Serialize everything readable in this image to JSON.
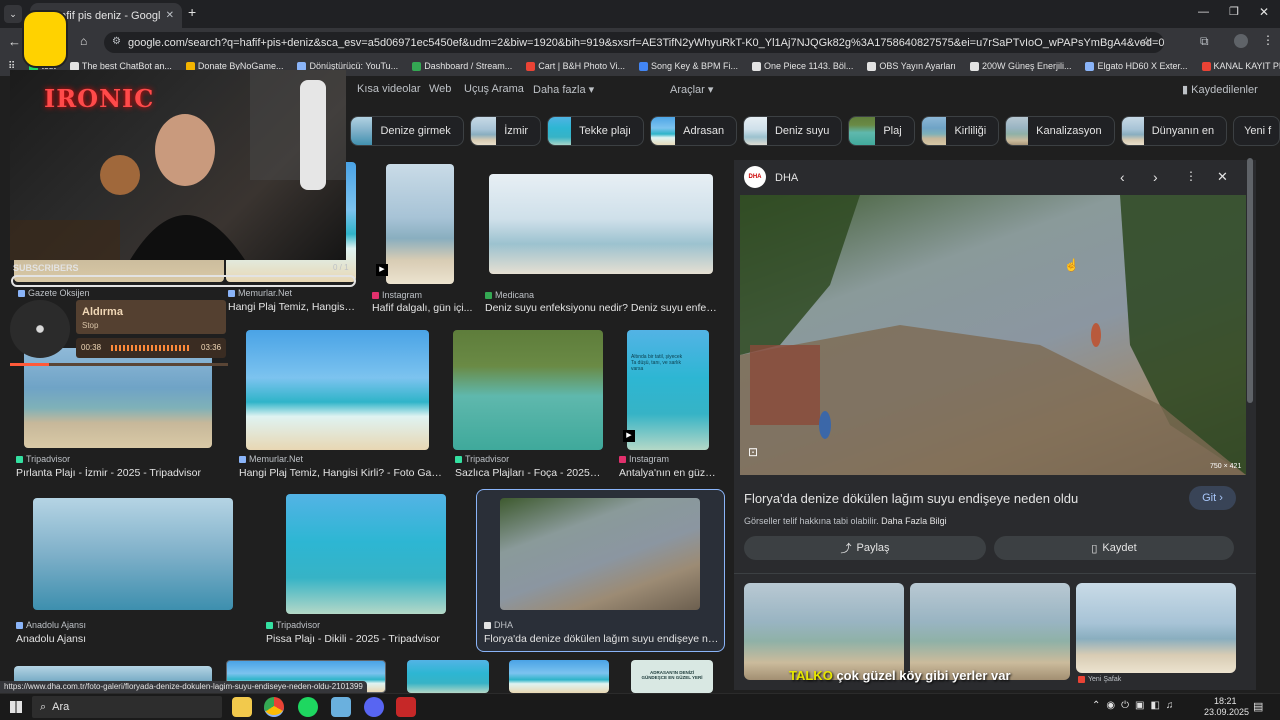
{
  "browser": {
    "tab_title": "hafif pis deniz - Google'da Ara",
    "url": "google.com/search?q=hafif+pis+deniz&sca_esv=a5d06971ec5450ef&udm=2&biw=1920&bih=919&sxsrf=AE3TifN2yWhyuRkT-K0_Yl1Aj7NJQGk82g%3A1758640827575&ei=u7rSaPTvIoO_wPAPsYmBgA4&ved=0ahUKEwi0ucLOI--PAxWDHxAIH...",
    "bookmarks": [
      {
        "label": "test",
        "color": "#1ed760"
      },
      {
        "label": "The best ChatBot an...",
        "color": "#e3e3e3"
      },
      {
        "label": "Donate ByNoGame...",
        "color": "#f4b400"
      },
      {
        "label": "Dönüştürücü: YouTu...",
        "color": "#8ab4f8"
      },
      {
        "label": "Dashboard / Stream...",
        "color": "#34a853"
      },
      {
        "label": "Cart | B&H Photo Vi...",
        "color": "#ea4335"
      },
      {
        "label": "Song Key & BPM Fi...",
        "color": "#4285f4"
      },
      {
        "label": "One Piece 1143. Böl...",
        "color": "#e3e3e3"
      },
      {
        "label": "OBS Yayın Ayarları",
        "color": "#e3e3e3"
      },
      {
        "label": "200W Güneş Enerjili...",
        "color": "#e3e3e3"
      },
      {
        "label": "Elgato HD60 X Exter...",
        "color": "#8ab4f8"
      },
      {
        "label": "KANAL KAYIT PROG...",
        "color": "#ea4335"
      }
    ]
  },
  "search_nav": {
    "links": [
      "Kısa videolar",
      "Web",
      "Uçuş Arama",
      "Daha fazla",
      "Araçlar"
    ],
    "saved": "Kaydedilenler"
  },
  "chips": [
    "Denize girmek",
    "İzmir",
    "Tekke plajı",
    "Adrasan",
    "Deniz suyu",
    "Plaj",
    "Kirliliği",
    "Kanalizasyon",
    "Dünyanın en",
    "Yeni f"
  ],
  "results": [
    {
      "source": "Gazete Oksijen",
      "title": "",
      "fav": "#8ab4f8"
    },
    {
      "source": "Memurlar.Net",
      "title": "Hangi Plaj Temiz, Hangisi ...",
      "fav": "#8ab4f8"
    },
    {
      "source": "Instagram",
      "title": "Hafif dalgalı, gün içi...",
      "fav": "#e1306c"
    },
    {
      "source": "Medicana",
      "title": "Deniz suyu enfeksiyonu nedir? Deniz suyu enfeksiy...",
      "fav": "#34a853"
    },
    {
      "source": "Tripadvisor",
      "title": "Pırlanta Plajı - İzmir - 2025 - Tripadvisor",
      "fav": "#34e0a1"
    },
    {
      "source": "Memurlar.Net",
      "title": "Hangi Plaj Temiz, Hangisi Kirli? - Foto Galer...",
      "fav": "#8ab4f8"
    },
    {
      "source": "Tripadvisor",
      "title": "Sazlıca Plajları - Foça - 2025 - ...",
      "fav": "#34e0a1"
    },
    {
      "source": "Instagram",
      "title": "Antalya'nın en güzel...",
      "fav": "#e1306c"
    },
    {
      "source": "Anadolu Ajansı",
      "title": "Anadolu Ajansı",
      "fav": "#8ab4f8"
    },
    {
      "source": "Tripadvisor",
      "title": "Pissa Plajı - Dikili - 2025 - Tripadvisor",
      "fav": "#34e0a1"
    },
    {
      "source": "DHA",
      "title": "Florya'da denize dökülen lağım suyu endişeye nede...",
      "fav": "#e3e3e3"
    }
  ],
  "instagram_img_text": "Altında bir tatil, şiyecek\nTa düşü, tanı, ve sarlık\nvarsa",
  "bottom_img_text": "ADRASAN'IN DENİZİ\nGÜNDEŞCE EN GÜZEL YERİ",
  "panel": {
    "source": "DHA",
    "image_size": "750 × 421",
    "title": "Florya'da denize dökülen lağım suyu endişeye neden oldu",
    "go_button": "Git",
    "copyright": "Görseller telif hakkına tabi olabilir.",
    "more_info": "Daha Fazla Bilgi",
    "share_button": "Paylaş",
    "save_button": "Kaydet",
    "related_bottom_source": "Yeni Şafak"
  },
  "status_url": "https://www.dha.com.tr/foto-galeri/floryada-denize-dokulen-lagim-suyu-endiseye-neden-oldu-2101399",
  "stream_overlay": {
    "logo_text": "IRONIC",
    "subscribers_label": "SUBSCRIBERS",
    "subscribers_count": "0 / 1",
    "song_title": "Aldırma",
    "song_status": "Stop",
    "time_elapsed": "00:38",
    "time_total": "03:36",
    "chat_user": "TALKO",
    "chat_text": "çok güzel köy gibi yerler var"
  },
  "taskbar": {
    "search_placeholder": "Ara",
    "time": "18:21",
    "date": "23.09.2025"
  }
}
